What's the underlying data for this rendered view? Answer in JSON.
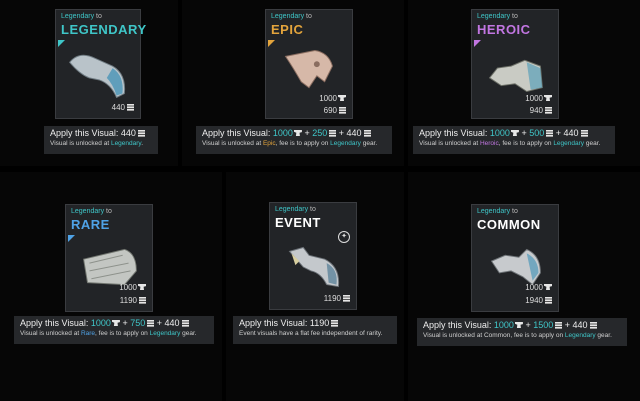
{
  "cards": [
    {
      "from": "Legendary",
      "to": "to",
      "rarity": "LEGENDARY",
      "rarity_color": "#3fc6c8",
      "steel": "",
      "cost": "440",
      "info": {
        "label": "Apply this Visual:",
        "steel": "",
        "plus1": "",
        "rarity_fee": "",
        "plus2": "",
        "total": "440",
        "l2_pre": "Visual is unlocked at ",
        "l2_rarity": "Legendary",
        "l2_mid": ".",
        "l2_leg": "",
        "l2_post": ""
      }
    },
    {
      "from": "Legendary",
      "to": "to",
      "rarity": "EPIC",
      "rarity_color": "#e3a43c",
      "steel": "1000",
      "cost": "690",
      "info": {
        "label": "Apply this Visual:",
        "steel": "1000",
        "plus1": "+",
        "rarity_fee": "250",
        "plus2": "+",
        "total": "440",
        "l2_pre": "Visual is unlocked at ",
        "l2_rarity": "Epic",
        "l2_mid": ", fee is to apply on ",
        "l2_leg": "Legendary",
        "l2_post": " gear."
      }
    },
    {
      "from": "Legendary",
      "to": "to",
      "rarity": "HEROIC",
      "rarity_color": "#c276e2",
      "steel": "1000",
      "cost": "940",
      "info": {
        "label": "Apply this Visual:",
        "steel": "1000",
        "plus1": "+",
        "rarity_fee": "500",
        "plus2": "+",
        "total": "440",
        "l2_pre": "Visual is unlocked at ",
        "l2_rarity": "Heroic",
        "l2_mid": ", fee is to apply on ",
        "l2_leg": "Legendary",
        "l2_post": " gear."
      }
    },
    {
      "from": "Legendary",
      "to": "to",
      "rarity": "RARE",
      "rarity_color": "#4fa2e6",
      "steel": "1000",
      "cost": "1190",
      "info": {
        "label": "Apply this Visual:",
        "steel": "1000",
        "plus1": "+",
        "rarity_fee": "750",
        "plus2": "+",
        "total": "440",
        "l2_pre": "Visual is unlocked at ",
        "l2_rarity": "Rare",
        "l2_mid": ", fee is to apply on ",
        "l2_leg": "Legendary",
        "l2_post": " gear."
      }
    },
    {
      "from": "Legendary",
      "to": "to",
      "rarity": "EVENT",
      "rarity_color": "#ffffff",
      "steel": "",
      "cost": "1190",
      "event_badge": "✦",
      "info": {
        "label": "Apply this Visual:",
        "total": "1190",
        "l2_text": "Event visuals have a flat fee independent of rarity."
      }
    },
    {
      "from": "Legendary",
      "to": "to",
      "rarity": "COMMON",
      "rarity_color": "#ffffff",
      "steel": "1000",
      "cost": "1940",
      "info": {
        "label": "Apply this Visual:",
        "steel": "1000",
        "plus1": "+",
        "rarity_fee": "1500",
        "plus2": "+",
        "total": "440",
        "l2_pre": "Visual is unlocked at ",
        "l2_rarity": "Common",
        "l2_mid": ", fee is to apply on ",
        "l2_leg": "Legendary",
        "l2_post": " gear."
      }
    }
  ],
  "icons": {
    "currency": "steel-coin-icon",
    "material": "anvil-icon"
  }
}
